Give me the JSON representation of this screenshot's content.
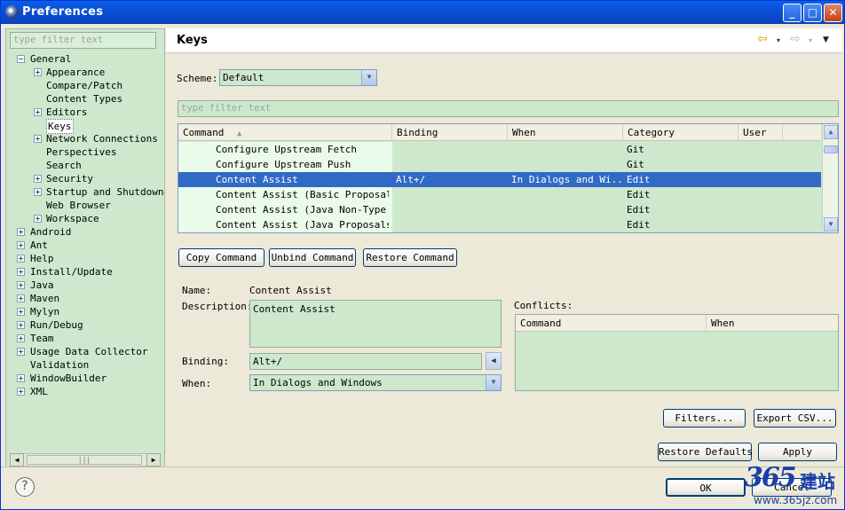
{
  "window": {
    "title": "Preferences",
    "minimize": "_",
    "maximize": "□",
    "close": "✕"
  },
  "sidebar": {
    "filter_placeholder": "type filter text",
    "tree": [
      {
        "label": "General",
        "expander": "−",
        "level": 0
      },
      {
        "label": "Appearance",
        "expander": "+",
        "level": 1
      },
      {
        "label": "Compare/Patch",
        "expander": "",
        "level": 1
      },
      {
        "label": "Content Types",
        "expander": "",
        "level": 1
      },
      {
        "label": "Editors",
        "expander": "+",
        "level": 1
      },
      {
        "label": "Keys",
        "expander": "",
        "level": 1,
        "selected": true
      },
      {
        "label": "Network Connections",
        "expander": "+",
        "level": 1
      },
      {
        "label": "Perspectives",
        "expander": "",
        "level": 1
      },
      {
        "label": "Search",
        "expander": "",
        "level": 1
      },
      {
        "label": "Security",
        "expander": "+",
        "level": 1
      },
      {
        "label": "Startup and Shutdown",
        "expander": "+",
        "level": 1
      },
      {
        "label": "Web Browser",
        "expander": "",
        "level": 1
      },
      {
        "label": "Workspace",
        "expander": "+",
        "level": 1
      },
      {
        "label": "Android",
        "expander": "+",
        "level": 0
      },
      {
        "label": "Ant",
        "expander": "+",
        "level": 0
      },
      {
        "label": "Help",
        "expander": "+",
        "level": 0
      },
      {
        "label": "Install/Update",
        "expander": "+",
        "level": 0
      },
      {
        "label": "Java",
        "expander": "+",
        "level": 0
      },
      {
        "label": "Maven",
        "expander": "+",
        "level": 0
      },
      {
        "label": "Mylyn",
        "expander": "+",
        "level": 0
      },
      {
        "label": "Run/Debug",
        "expander": "+",
        "level": 0
      },
      {
        "label": "Team",
        "expander": "+",
        "level": 0
      },
      {
        "label": "Usage Data Collector",
        "expander": "+",
        "level": 0
      },
      {
        "label": "Validation",
        "expander": "",
        "level": 0
      },
      {
        "label": "WindowBuilder",
        "expander": "+",
        "level": 0
      },
      {
        "label": "XML",
        "expander": "+",
        "level": 0
      }
    ],
    "scroll_left": "◀",
    "scroll_right": "▶",
    "scroll_grip": "|||"
  },
  "header": {
    "title": "Keys",
    "back_icon": "⇦",
    "forward_icon": "⇨",
    "dropdown": "▾",
    "menu": "▼"
  },
  "scheme": {
    "label": "Scheme:",
    "value": "Default",
    "drop": "▼"
  },
  "filter_placeholder": "type filter text",
  "table": {
    "sort_indicator": "▲",
    "columns": [
      "Command",
      "Binding",
      "When",
      "Category",
      "User"
    ],
    "rows": [
      {
        "command": "Configure Upstream Fetch",
        "binding": "",
        "when": "",
        "category": "Git",
        "user": ""
      },
      {
        "command": "Configure Upstream Push",
        "binding": "",
        "when": "",
        "category": "Git",
        "user": ""
      },
      {
        "command": "Content Assist",
        "binding": "Alt+/",
        "when": "In Dialogs and Wi...",
        "category": "Edit",
        "user": "",
        "selected": true
      },
      {
        "command": "Content Assist (Basic Proposals)",
        "binding": "",
        "when": "",
        "category": "Edit",
        "user": ""
      },
      {
        "command": "Content Assist (Java Non-Type Pro",
        "binding": "",
        "when": "",
        "category": "Edit",
        "user": ""
      },
      {
        "command": "Content Assist (Java Proposals (T",
        "binding": "",
        "when": "",
        "category": "Edit",
        "user": ""
      }
    ],
    "scroll_up": "▲",
    "scroll_down": "▼"
  },
  "actions": {
    "copy": "Copy Command",
    "unbind": "Unbind Command",
    "restore": "Restore Command"
  },
  "details": {
    "name_label": "Name:",
    "name_value": "Content Assist",
    "description_label": "Description:",
    "description_value": "Content Assist",
    "binding_label": "Binding:",
    "binding_value": "Alt+/",
    "binding_btn": "◀",
    "when_label": "When:",
    "when_value": "In Dialogs and Windows",
    "when_drop": "▼"
  },
  "conflicts": {
    "label": "Conflicts:",
    "columns": [
      "Command",
      "When"
    ]
  },
  "buttons": {
    "filters": "Filters...",
    "export": "Export CSV...",
    "restore_defaults": "Restore Defaults",
    "apply": "Apply",
    "ok": "OK",
    "cancel": "Cancel"
  },
  "help_icon": "?",
  "watermark": {
    "number": "365",
    "chinese": "建站",
    "url": "www.365jz.com"
  }
}
